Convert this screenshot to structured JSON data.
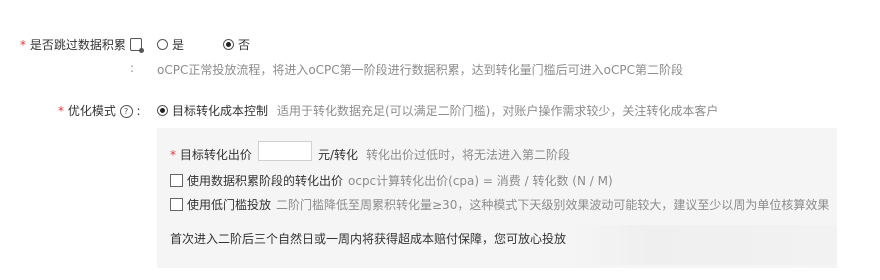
{
  "skip_accumulation": {
    "label": "是否跳过数据积累",
    "options": [
      {
        "label": "是",
        "selected": false
      },
      {
        "label": "否",
        "selected": true
      }
    ],
    "colon": ":",
    "hint": "oCPC正常投放流程，将进入oCPC第一阶段进行数据积累，达到转化量门槛后可进入oCPC第二阶段"
  },
  "optimize_mode": {
    "label": "优化模式",
    "option_label": "目标转化成本控制",
    "option_hint": "适用于转化数据充足(可以满足二阶门槛)，对账户操作需求较少，关注转化成本客户"
  },
  "panel": {
    "target_bid_label": "目标转化出价",
    "target_bid_value": "",
    "target_bid_unit": "元/转化",
    "target_bid_hint": "转化出价过低时，将无法进入第二阶段",
    "use_accum_label": "使用数据积累阶段的转化出价",
    "use_accum_hint": "ocpc计算转化出价(cpa) = 消费 / 转化数 (N / M)",
    "low_threshold_label": "使用低门槛投放",
    "low_threshold_hint": "二阶门槛降低至周累积转化量≥30，这种模式下天级别效果波动可能较大，建议至少以周为单位核算效果",
    "guarantee_text": "首次进入二阶后三个自然日或一周内将获得超成本赔付保障，您可放心投放"
  }
}
